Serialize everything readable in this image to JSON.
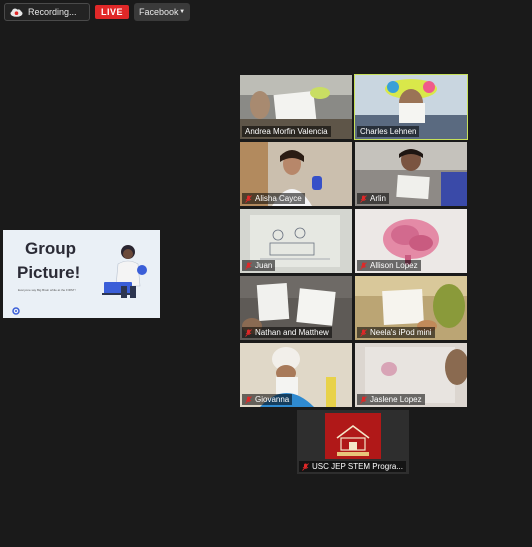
{
  "toolbar": {
    "recording_label": "Recording...",
    "live_label": "LIVE",
    "stream_target": "Facebook"
  },
  "slide": {
    "title_line1": "Group",
    "title_line2": "Picture!",
    "subtitle": "Everyone say Big Brain while at the FIRST!"
  },
  "participants": [
    {
      "name": "Andrea Morfin Valencia",
      "muted": false
    },
    {
      "name": "Charles Lehnen",
      "muted": false
    },
    {
      "name": "Alisha Cayce",
      "muted": true
    },
    {
      "name": "Arlin",
      "muted": true
    },
    {
      "name": "Juan",
      "muted": true
    },
    {
      "name": "Allison Lopez",
      "muted": true
    },
    {
      "name": "Nathan and Matthew",
      "muted": true
    },
    {
      "name": "Neela's iPod mini",
      "muted": true
    },
    {
      "name": "Giovanna",
      "muted": true
    },
    {
      "name": "Jaslene Lopez",
      "muted": true
    },
    {
      "name": "USC JEP STEM Progra...",
      "muted": true
    }
  ],
  "colors": {
    "background": "#1a1a1a",
    "active_speaker": "#c6e05a",
    "live_badge": "#e02828",
    "muted_icon": "#e02828",
    "host_tile": "#b01818"
  }
}
